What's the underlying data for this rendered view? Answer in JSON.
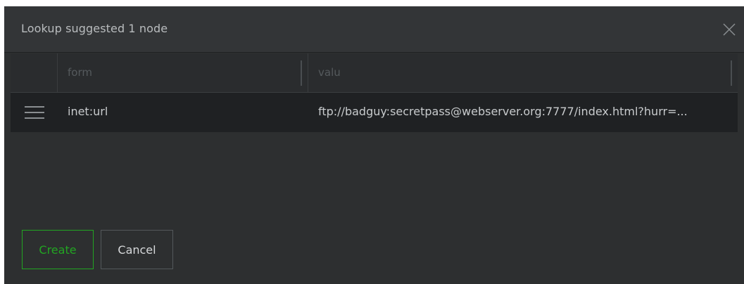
{
  "dialog": {
    "title": "Lookup suggested 1 node",
    "close_icon": "close-icon"
  },
  "grid": {
    "columns": [
      {
        "key": "handle",
        "label": ""
      },
      {
        "key": "form",
        "label": "form"
      },
      {
        "key": "valu",
        "label": "valu"
      }
    ],
    "rows": [
      {
        "handle_icon": "drag-handle-icon",
        "form": "inet:url",
        "valu": "ftp://badguy:secretpass@webserver.org:7777/index.html?hurr=..."
      }
    ]
  },
  "buttons": {
    "create_label": "Create",
    "cancel_label": "Cancel"
  },
  "colors": {
    "accent_green": "#22a522",
    "background": "#2d2f30",
    "header": "#333537",
    "row": "#1f2123"
  }
}
